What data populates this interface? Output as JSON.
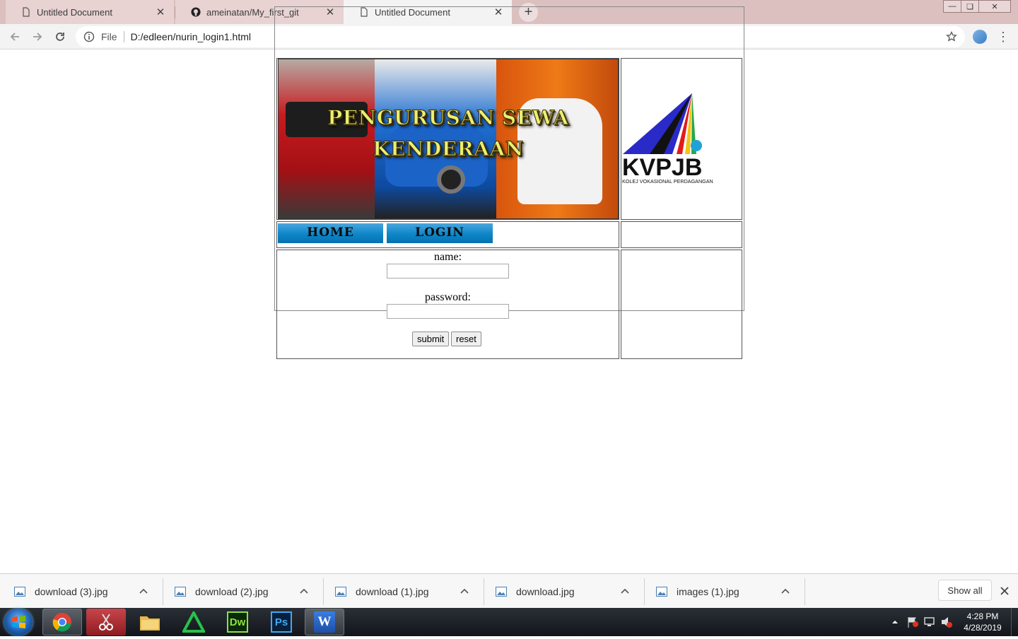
{
  "browser": {
    "tabs": [
      {
        "label": "Untitled Document",
        "icon": "document-icon",
        "active": false
      },
      {
        "label": "ameinatan/My_first_git",
        "icon": "github-icon",
        "active": false
      },
      {
        "label": "Untitled Document",
        "icon": "document-icon",
        "active": true
      }
    ],
    "omnibox": {
      "scheme": "File",
      "url": "D:/edleen/nurin_login1.html"
    }
  },
  "page": {
    "banner_title_line1": "PENGURUSAN SEWA",
    "banner_title_line2": "KENDERAAN",
    "logo_text": "KVPJB",
    "logo_subtext": "KOLEJ VOKASIONAL PERDAGANGAN",
    "nav": {
      "home": "HOME",
      "login": "LOGIN"
    },
    "form": {
      "name_label": "name:",
      "name_value": "",
      "password_label": "password:",
      "password_value": "",
      "submit_label": "submit",
      "reset_label": "reset"
    }
  },
  "downloads": {
    "items": [
      {
        "name": "download (3).jpg"
      },
      {
        "name": "download (2).jpg"
      },
      {
        "name": "download (1).jpg"
      },
      {
        "name": "download.jpg"
      },
      {
        "name": "images (1).jpg"
      }
    ],
    "show_all_label": "Show all"
  },
  "taskbar": {
    "apps": [
      "chrome-icon",
      "snipping-tool-icon",
      "file-explorer-icon",
      "green-triangle-app-icon",
      "dreamweaver-icon",
      "photoshop-icon",
      "word-icon"
    ],
    "dreamweaver_label": "Dw",
    "photoshop_label": "Ps",
    "word_label": "W",
    "time": "4:28 PM",
    "date": "4/28/2019"
  },
  "colors": {
    "tabstrip": "#dcc0c0",
    "nav_button": "#0d86c9",
    "banner_text": "#e9f070"
  }
}
